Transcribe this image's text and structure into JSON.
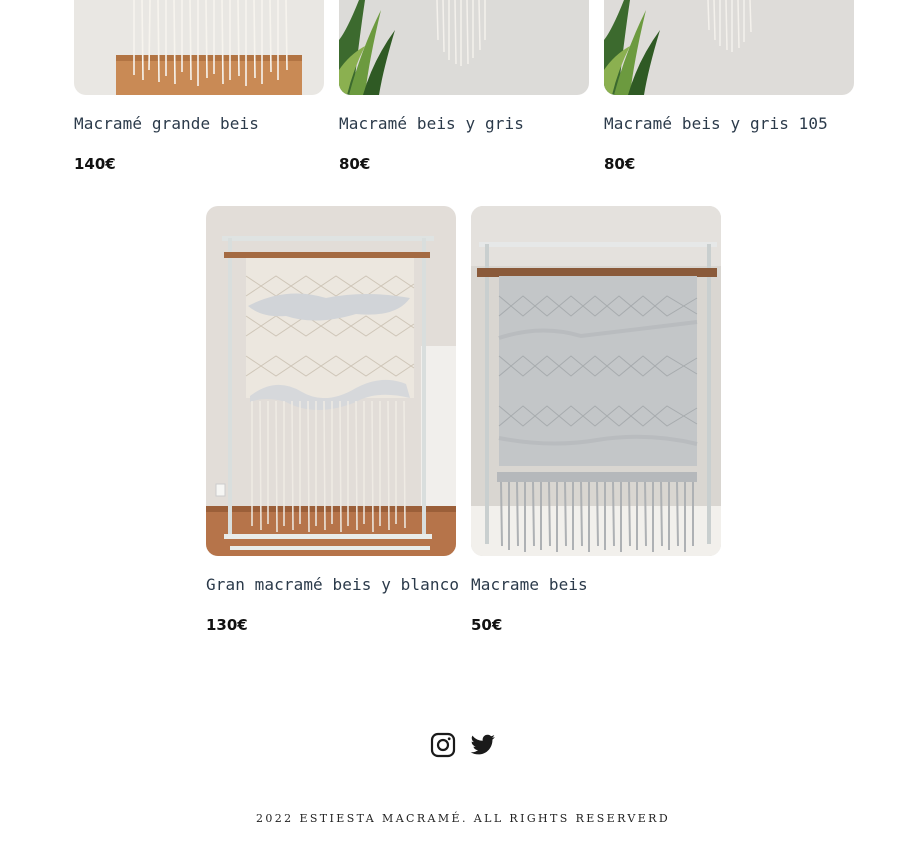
{
  "products_row1": [
    {
      "title": "Macramé grande beis",
      "price": "140€"
    },
    {
      "title": "Macramé beis y gris",
      "price": "80€"
    },
    {
      "title": "Macramé beis y gris 105",
      "price": "80€"
    }
  ],
  "products_row2": [
    {
      "title": "Gran macramé beis y blanco",
      "price": "130€"
    },
    {
      "title": "Macrame beis",
      "price": "50€"
    }
  ],
  "footer": {
    "icons": [
      "instagram-icon",
      "twitter-icon"
    ],
    "copyright": "2022 ESTIESTA MACRAMÉ. ALL RIGHTS RESERVERD"
  }
}
